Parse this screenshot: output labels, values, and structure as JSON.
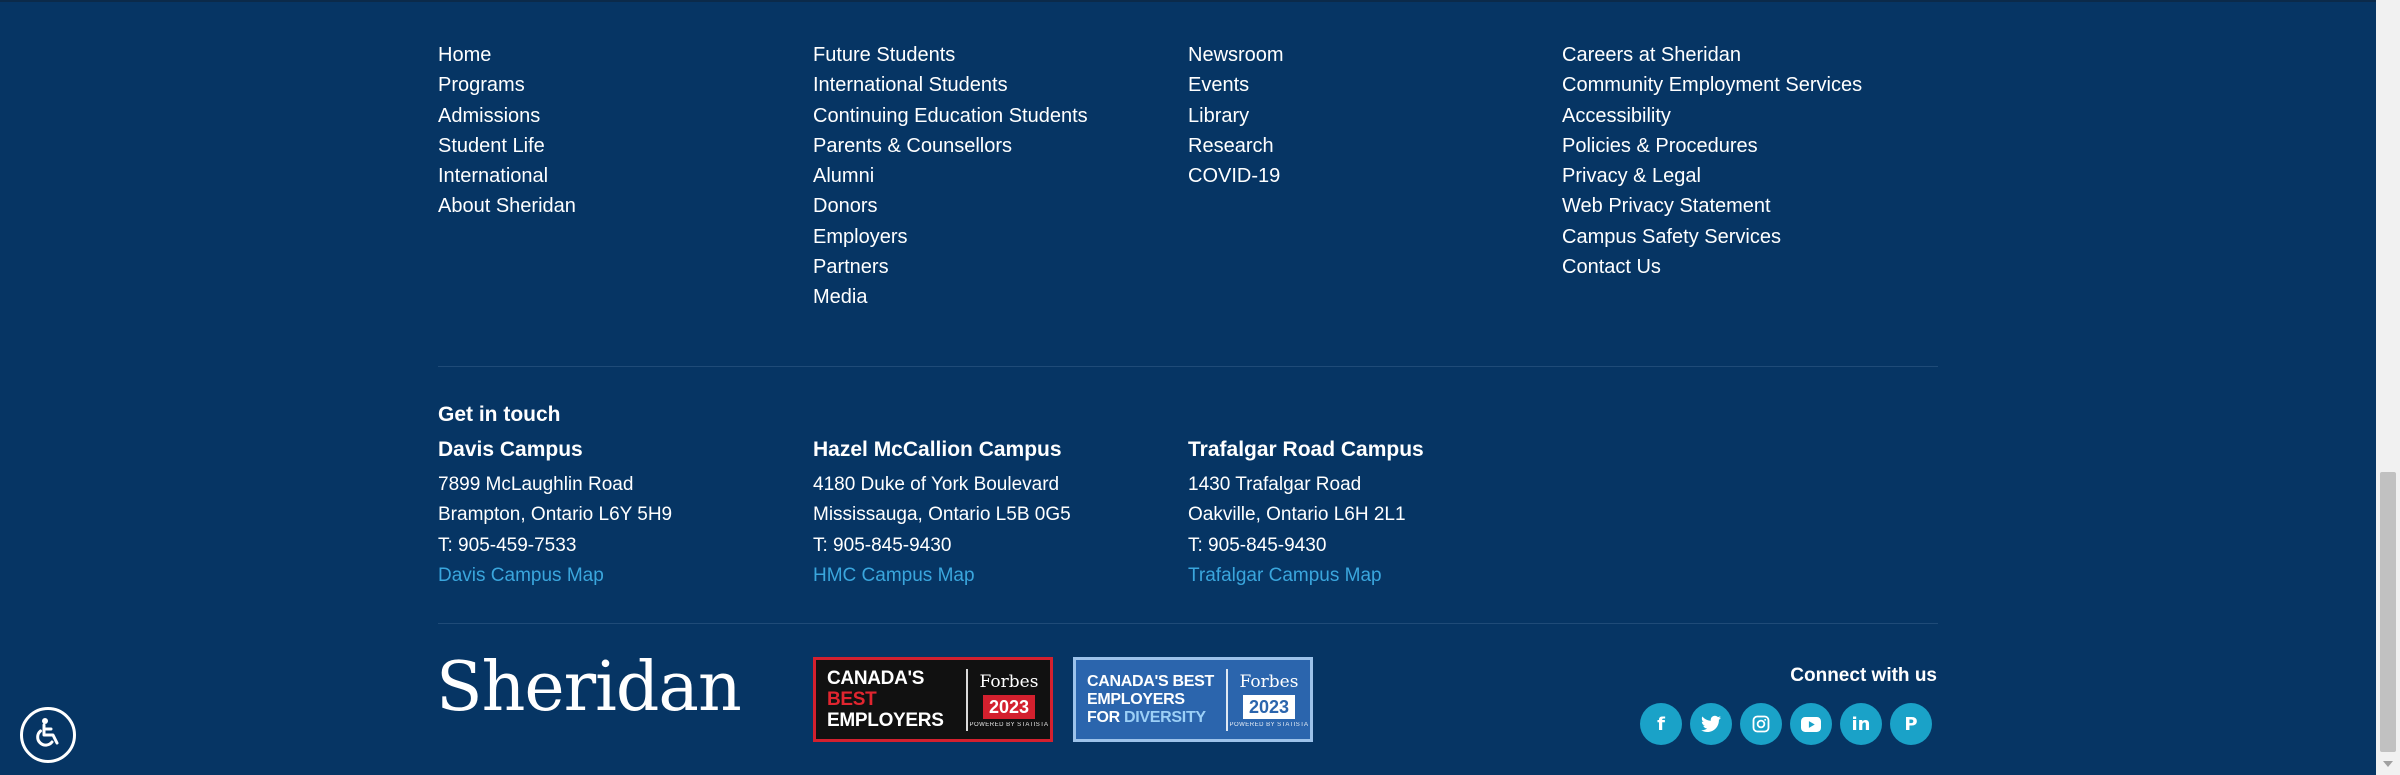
{
  "nav_columns": [
    [
      "Home",
      "Programs",
      "Admissions",
      "Student Life",
      "International",
      "About Sheridan"
    ],
    [
      "Future Students",
      "International Students",
      "Continuing Education Students",
      "Parents & Counsellors",
      "Alumni",
      "Donors",
      "Employers",
      "Partners",
      "Media"
    ],
    [
      "Newsroom",
      "Events",
      "Library",
      "Research",
      "COVID-19"
    ],
    [
      "Careers at Sheridan",
      "Community Employment Services",
      "Accessibility",
      "Policies & Procedures",
      "Privacy & Legal",
      "Web Privacy Statement",
      "Campus Safety Services",
      "Contact Us"
    ]
  ],
  "contact": {
    "heading": "Get in touch",
    "campuses": [
      {
        "name": "Davis Campus",
        "address1": "7899 McLaughlin Road",
        "address2": "Brampton, Ontario L6Y 5H9",
        "phone": "T: 905-459-7533",
        "map_link": "Davis Campus Map"
      },
      {
        "name": "Hazel McCallion Campus",
        "address1": "4180 Duke of York Boulevard",
        "address2": "Mississauga, Ontario L5B 0G5",
        "phone": "T: 905-845-9430",
        "map_link": "HMC Campus Map"
      },
      {
        "name": "Trafalgar Road Campus",
        "address1": "1430 Trafalgar Road",
        "address2": "Oakville, Ontario L6H 2L1",
        "phone": "T: 905-845-9430",
        "map_link": "Trafalgar Campus Map"
      }
    ]
  },
  "logo": "Sheridan",
  "badges": [
    {
      "line1a": "CANADA'S ",
      "line1b": "BEST",
      "line2": "EMPLOYERS",
      "line3": "",
      "line3b": "",
      "brand": "Forbes",
      "year": "2023",
      "powered": "POWERED BY STATISTA"
    },
    {
      "line1a": "CANADA'S BEST",
      "line1b": "",
      "line2": "EMPLOYERS",
      "line3": "FOR ",
      "line3b": "DIVERSITY",
      "brand": "Forbes",
      "year": "2023",
      "powered": "POWERED BY STATISTA"
    }
  ],
  "social": {
    "label": "Connect with us",
    "icons": [
      {
        "name": "facebook-icon",
        "glyph": "f"
      },
      {
        "name": "twitter-icon",
        "glyph": "🐦"
      },
      {
        "name": "instagram-icon",
        "glyph": "◎"
      },
      {
        "name": "youtube-icon",
        "glyph": "▶"
      },
      {
        "name": "linkedin-icon",
        "glyph": "in"
      },
      {
        "name": "pinterest-icon",
        "glyph": "P"
      }
    ]
  },
  "colors": {
    "background": "#063564",
    "link_accent": "#3aa6dd",
    "social": "#1aa2c8"
  }
}
